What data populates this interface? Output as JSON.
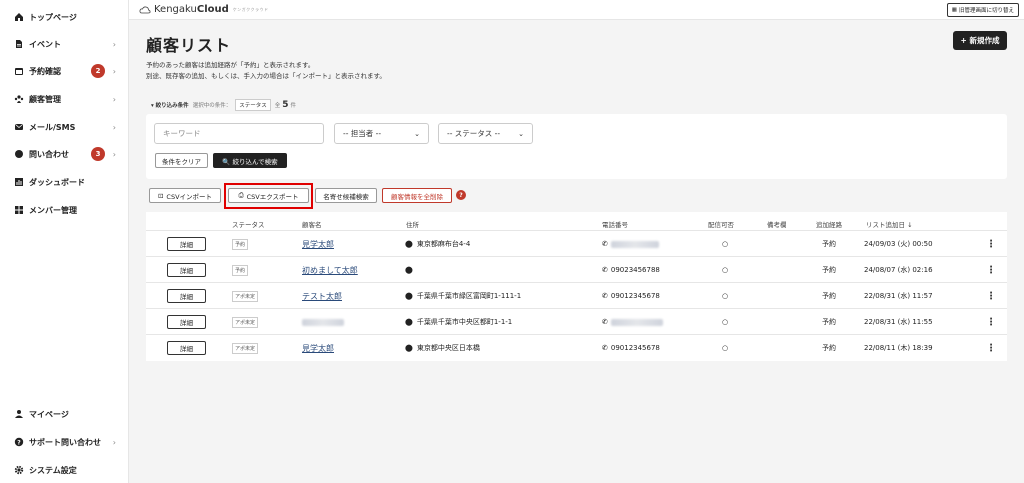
{
  "sidebar": {
    "items": [
      {
        "label": "トップページ"
      },
      {
        "label": "イベント"
      },
      {
        "label": "予約確認",
        "badge": "2"
      },
      {
        "label": "顧客管理"
      },
      {
        "label": "メール/SMS"
      },
      {
        "label": "問い合わせ",
        "badge": "3"
      },
      {
        "label": "ダッシュボード"
      },
      {
        "label": "メンバー管理"
      }
    ],
    "bottom": [
      {
        "label": "マイページ"
      },
      {
        "label": "サポート問い合わせ"
      },
      {
        "label": "システム設定"
      }
    ]
  },
  "header": {
    "logo_light": "Kengaku",
    "logo_bold": "Cloud",
    "logo_sub": "ケンガククラウド",
    "switch_label": "旧管理画面に切り替え"
  },
  "page": {
    "title": "顧客リスト",
    "new_button": "+ 新規作成",
    "desc_line1": "予約のあった顧客は追加経路が「予約」と表示されます。",
    "desc_line2": "別途、既存客の追加、もしくは、手入力の場合は「インポート」と表示されます。"
  },
  "filter": {
    "label": "▾ 絞り込み条件",
    "current": "選択中の条件：",
    "chip": "ステータス",
    "total_prefix": "全",
    "total_count": "5",
    "total_suffix": "件",
    "keyword_placeholder": "キーワード",
    "staff_select": "-- 担当者 --",
    "status_select": "-- ステータス --",
    "clear_button": "条件をクリア",
    "search_button": "🔍 絞り込んで検索"
  },
  "actions": {
    "import": "CSVインポート",
    "export": "CSVエクスポート",
    "namesearch": "名寄せ候補検索",
    "delete_all": "顧客情報を全削除",
    "help": "?"
  },
  "table": {
    "headers": {
      "status": "ステータス",
      "name": "顧客名",
      "address": "住所",
      "phone": "電話番号",
      "delivery": "配信可否",
      "note": "備考欄",
      "route": "追加経路",
      "added": "リスト追加日 ↓"
    },
    "detail_label": "詳細",
    "rows": [
      {
        "status": "予約",
        "name": "見学太郎",
        "address": "東京都麻布台4-4",
        "phone": "",
        "delivery": "○",
        "route": "予約",
        "added": "24/09/03 (火) 00:50"
      },
      {
        "status": "予約",
        "name": "初めまして太郎",
        "address": "",
        "phone": "09023456788",
        "delivery": "○",
        "route": "予約",
        "added": "24/08/07 (水) 02:16"
      },
      {
        "status": "アポ未定",
        "name": "テスト太郎",
        "address": "千葉県千葉市緑区富岡町1-111-1",
        "phone": "09012345678",
        "delivery": "○",
        "route": "予約",
        "added": "22/08/31 (水) 11:57"
      },
      {
        "status": "アポ未定",
        "name": "",
        "address": "千葉県千葉市中央区都町1-1-1",
        "phone": "",
        "delivery": "○",
        "route": "予約",
        "added": "22/08/31 (水) 11:55"
      },
      {
        "status": "アポ未定",
        "name": "見学太郎",
        "address": "東京都中央区日本橋",
        "phone": "09012345678",
        "delivery": "○",
        "route": "予約",
        "added": "22/08/11 (木) 18:39"
      }
    ]
  }
}
